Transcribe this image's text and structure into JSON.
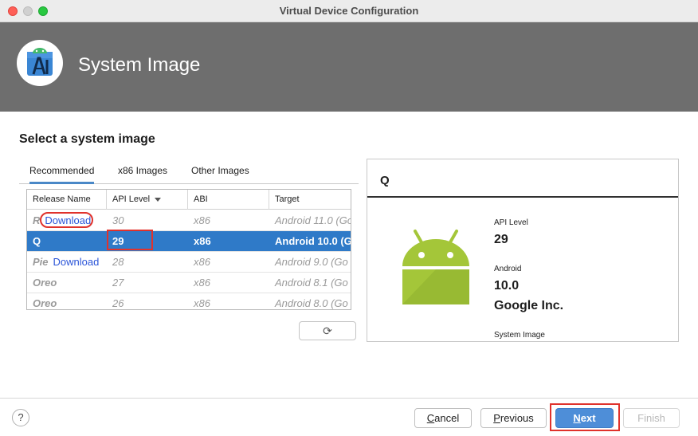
{
  "window": {
    "title": "Virtual Device Configuration"
  },
  "header": {
    "title": "System Image",
    "logo_icon": "android-studio-logo"
  },
  "section_title": "Select a system image",
  "tabs": [
    {
      "label": "Recommended",
      "active": true
    },
    {
      "label": "x86 Images",
      "active": false
    },
    {
      "label": "Other Images",
      "active": false
    }
  ],
  "table": {
    "columns": [
      "Release Name",
      "API Level",
      "ABI",
      "Target"
    ],
    "sort_column": "API Level",
    "rows": [
      {
        "release": "R",
        "action": "Download",
        "api": "30",
        "abi": "x86",
        "target": "Android 11.0 (Go",
        "selected": false
      },
      {
        "release": "Q",
        "action": "",
        "api": "29",
        "abi": "x86",
        "target": "Android 10.0 (G",
        "selected": true
      },
      {
        "release": "Pie",
        "action": "Download",
        "api": "28",
        "abi": "x86",
        "target": "Android 9.0 (Go",
        "selected": false
      },
      {
        "release": "Oreo",
        "action": "",
        "api": "27",
        "abi": "x86",
        "target": "Android 8.1 (Go",
        "selected": false
      },
      {
        "release": "Oreo",
        "action": "",
        "api": "26",
        "abi": "x86",
        "target": "Android 8.0 (Go",
        "selected": false
      }
    ]
  },
  "refresh_icon": "refresh-icon",
  "detail": {
    "title": "Q",
    "api_level_label": "API Level",
    "api_level": "29",
    "android_label": "Android",
    "android_version": "10.0",
    "vendor": "Google Inc.",
    "system_image_label": "System Image"
  },
  "footer": {
    "help": "?",
    "cancel_underline": "C",
    "cancel_rest": "ancel",
    "previous_underline": "P",
    "previous_rest": "revious",
    "next_underline": "N",
    "next_rest": "ext",
    "finish": "Finish"
  },
  "colors": {
    "header_bg": "#6e6e6e",
    "selection": "#2f7ac8",
    "primary_button": "#4e8ed8",
    "android_green": "#a4c639",
    "highlight_red": "#e0322c",
    "link": "#2a54d8"
  }
}
